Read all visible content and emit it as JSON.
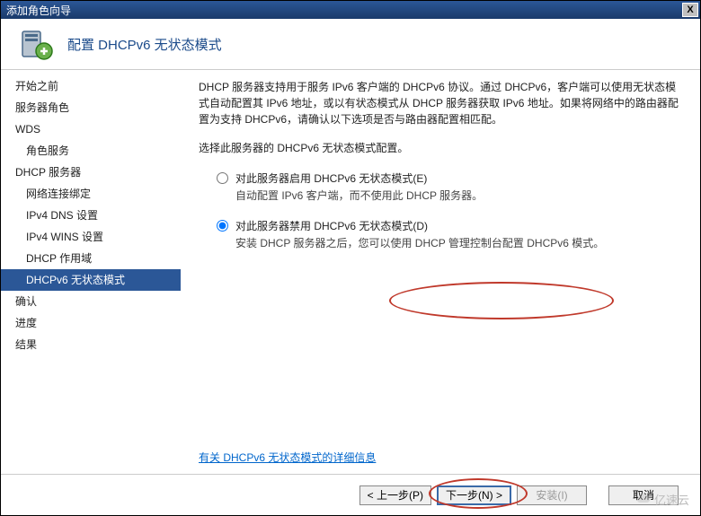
{
  "window": {
    "title": "添加角色向导",
    "close": "X"
  },
  "header": {
    "title": "配置 DHCPv6 无状态模式"
  },
  "sidebar": {
    "items": [
      {
        "label": "开始之前",
        "lvl": 1
      },
      {
        "label": "服务器角色",
        "lvl": 1
      },
      {
        "label": "WDS",
        "lvl": 1
      },
      {
        "label": "角色服务",
        "lvl": 2
      },
      {
        "label": "DHCP 服务器",
        "lvl": 1
      },
      {
        "label": "网络连接绑定",
        "lvl": 2
      },
      {
        "label": "IPv4 DNS 设置",
        "lvl": 2
      },
      {
        "label": "IPv4 WINS 设置",
        "lvl": 2
      },
      {
        "label": "DHCP 作用域",
        "lvl": 2
      },
      {
        "label": "DHCPv6 无状态模式",
        "lvl": 2,
        "active": true
      },
      {
        "label": "确认",
        "lvl": 1
      },
      {
        "label": "进度",
        "lvl": 1
      },
      {
        "label": "结果",
        "lvl": 1
      }
    ]
  },
  "content": {
    "intro": "DHCP 服务器支持用于服务 IPv6 客户端的 DHCPv6 协议。通过 DHCPv6，客户端可以使用无状态模式自动配置其 IPv6 地址，或以有状态模式从 DHCP 服务器获取 IPv6 地址。如果将网络中的路由器配置为支持 DHCPv6，请确认以下选项是否与路由器配置相匹配。",
    "prompt": "选择此服务器的 DHCPv6 无状态模式配置。",
    "opt_enable": {
      "label": "对此服务器启用 DHCPv6 无状态模式(E)",
      "desc": "自动配置 IPv6 客户端，而不使用此 DHCP 服务器。"
    },
    "opt_disable": {
      "label": "对此服务器禁用 DHCPv6 无状态模式(D)",
      "desc": "安装 DHCP 服务器之后，您可以使用 DHCP 管理控制台配置 DHCPv6 模式。"
    },
    "link": "有关 DHCPv6 无状态模式的详细信息"
  },
  "footer": {
    "prev": "< 上一步(P)",
    "next": "下一步(N) >",
    "install": "安装(I)",
    "cancel": "取消"
  },
  "watermark": "亿速云"
}
